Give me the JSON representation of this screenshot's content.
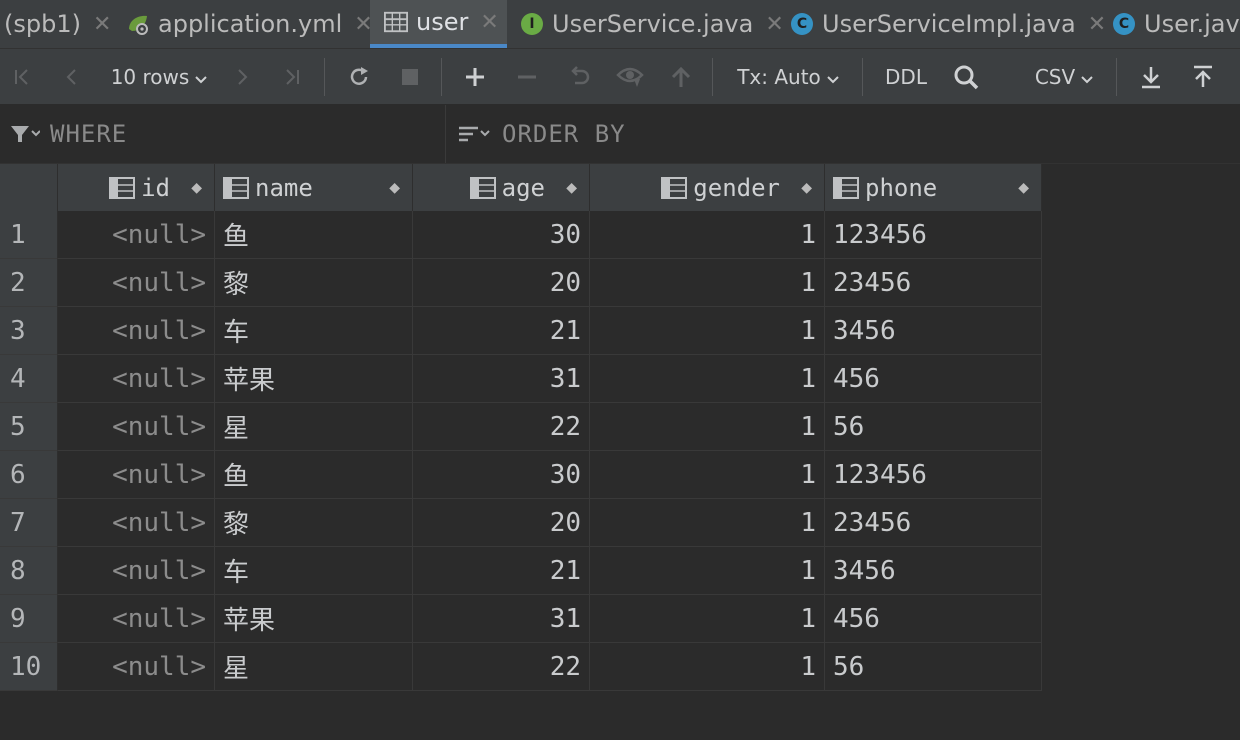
{
  "tabs": [
    {
      "label": "(spb1)",
      "icon": "none"
    },
    {
      "label": "application.yml",
      "icon": "spring-config-icon"
    },
    {
      "label": "user",
      "icon": "table-icon",
      "active": true
    },
    {
      "label": "UserService.java",
      "icon": "interface-icon",
      "badge": "I"
    },
    {
      "label": "UserServiceImpl.java",
      "icon": "class-icon",
      "badge": "C"
    },
    {
      "label": "User.java",
      "icon": "class-icon",
      "badge": "C"
    }
  ],
  "toolbar": {
    "rows_label": "10 rows",
    "tx_label": "Tx: Auto",
    "ddl_label": "DDL",
    "format_label": "CSV"
  },
  "filters": {
    "where_label": "WHERE",
    "order_label": "ORDER BY"
  },
  "table": {
    "columns": [
      "id",
      "name",
      "age",
      "gender",
      "phone"
    ],
    "rows": [
      {
        "n": "1",
        "id": "<null>",
        "name": "鱼",
        "age": "30",
        "gender": "1",
        "phone": "123456"
      },
      {
        "n": "2",
        "id": "<null>",
        "name": "黎",
        "age": "20",
        "gender": "1",
        "phone": "23456"
      },
      {
        "n": "3",
        "id": "<null>",
        "name": "车",
        "age": "21",
        "gender": "1",
        "phone": "3456"
      },
      {
        "n": "4",
        "id": "<null>",
        "name": "苹果",
        "age": "31",
        "gender": "1",
        "phone": "456"
      },
      {
        "n": "5",
        "id": "<null>",
        "name": "星",
        "age": "22",
        "gender": "1",
        "phone": "56"
      },
      {
        "n": "6",
        "id": "<null>",
        "name": "鱼",
        "age": "30",
        "gender": "1",
        "phone": "123456"
      },
      {
        "n": "7",
        "id": "<null>",
        "name": "黎",
        "age": "20",
        "gender": "1",
        "phone": "23456"
      },
      {
        "n": "8",
        "id": "<null>",
        "name": "车",
        "age": "21",
        "gender": "1",
        "phone": "3456"
      },
      {
        "n": "9",
        "id": "<null>",
        "name": "苹果",
        "age": "31",
        "gender": "1",
        "phone": "456"
      },
      {
        "n": "10",
        "id": "<null>",
        "name": "星",
        "age": "22",
        "gender": "1",
        "phone": "56"
      }
    ]
  },
  "colors": {
    "accent": "#4a88c7",
    "interface_badge": "#6aab45",
    "class_badge": "#3592c4"
  }
}
